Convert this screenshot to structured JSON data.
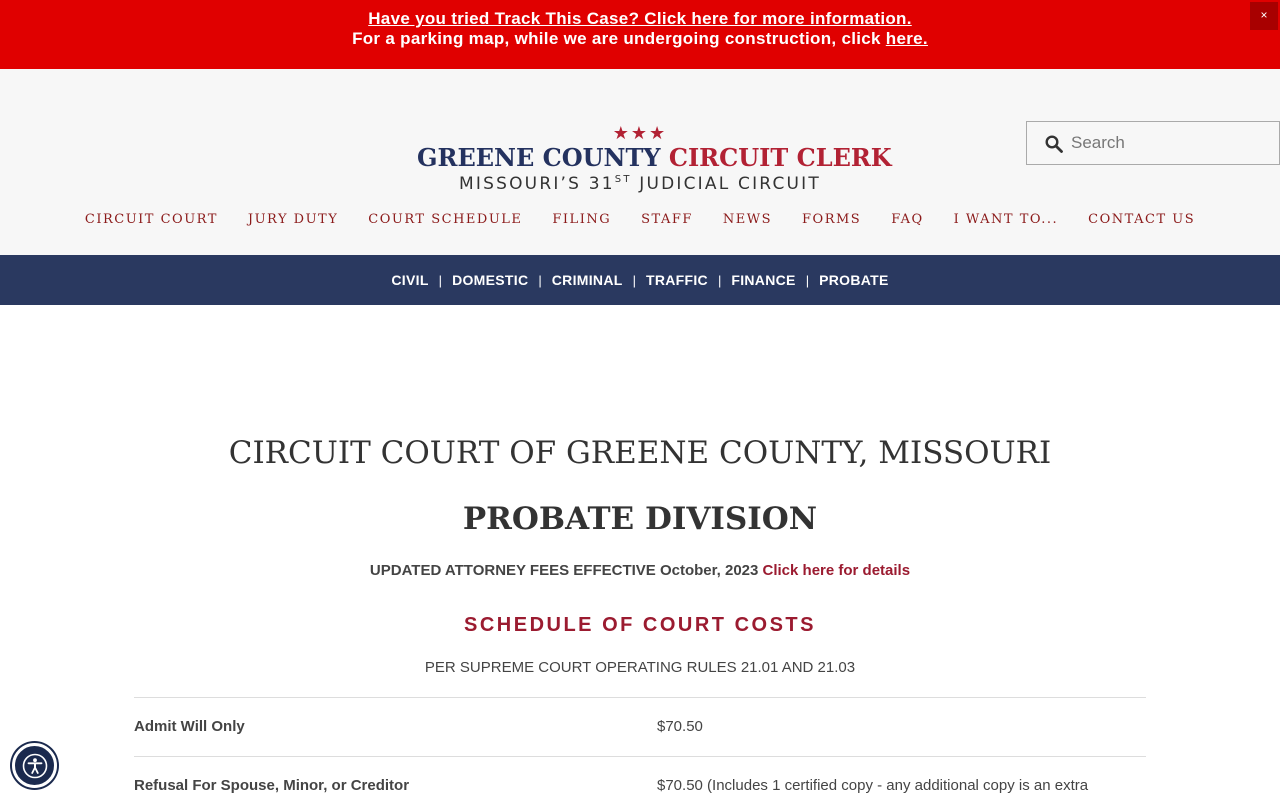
{
  "alert": {
    "line1_link": "Have you tried Track This Case? Click here for more information.",
    "line2_text": "For a parking map, while we are undergoing construction, click ",
    "line2_link": "here.",
    "close_label": "×"
  },
  "logo": {
    "stars": "★★★",
    "title_blue": "GREENE COUNTY ",
    "title_red": "CIRCUIT CLERK",
    "sub_pre": "MISSOURI’S 31",
    "sub_sup": "ST",
    "sub_post": " JUDICIAL CIRCUIT"
  },
  "search": {
    "placeholder": "Search",
    "value": ""
  },
  "main_nav": [
    "CIRCUIT COURT",
    "JURY DUTY",
    "COURT SCHEDULE",
    "FILING",
    "STAFF",
    "NEWS",
    "FORMS",
    "FAQ",
    "I WANT TO...",
    "CONTACT US"
  ],
  "sub_nav": [
    "CIVIL",
    "DOMESTIC",
    "CRIMINAL",
    "TRAFFIC",
    "FINANCE",
    "PROBATE"
  ],
  "sub_nav_separator": "|",
  "content": {
    "heading": "CIRCUIT COURT OF GREENE COUNTY, MISSOURI",
    "division": "PROBATE DIVISION",
    "notice_text": "UPDATED ATTORNEY FEES EFFECTIVE October, 2023 ",
    "notice_link": "Click here for details",
    "schedule_title": "SCHEDULE OF COURT COSTS",
    "rules_text": "PER SUPREME COURT OPERATING RULES 21.01 AND 21.03",
    "fees": [
      {
        "name": "Admit Will Only",
        "value": "$70.50"
      },
      {
        "name": "Refusal For Spouse, Minor, or Creditor",
        "value": "$70.50 (Includes 1 certified copy - any additional copy is an extra"
      }
    ]
  },
  "colors": {
    "alert_bg": "#e00000",
    "brand_blue": "#24325f",
    "brand_red": "#b22234",
    "subnav_bg": "#2a3960",
    "accent": "#9b1b30"
  }
}
